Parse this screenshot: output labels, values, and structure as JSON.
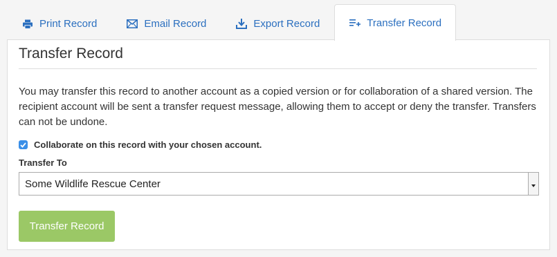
{
  "tabs": [
    {
      "label": "Print Record",
      "icon": "printer-icon",
      "active": false
    },
    {
      "label": "Email Record",
      "icon": "envelope-icon",
      "active": false
    },
    {
      "label": "Export Record",
      "icon": "download-icon",
      "active": false
    },
    {
      "label": "Transfer Record",
      "icon": "transfer-list-icon",
      "active": true
    }
  ],
  "panel": {
    "title": "Transfer Record",
    "description": "You may transfer this record to another account as a copied version or for collaboration of a shared version. The recipient account will be sent a transfer request message, allowing them to accept or deny the transfer. Transfers can not be undone.",
    "collaborate_checkbox": {
      "label": "Collaborate on this record with your chosen account.",
      "checked": true
    },
    "transfer_to": {
      "label": "Transfer To",
      "selected": "Some Wildlife Rescue Center"
    },
    "submit_label": "Transfer Record"
  },
  "colors": {
    "link": "#2b6fbf",
    "checkbox": "#3a8fe8",
    "button": "#9bc866",
    "background": "#f5f5f5"
  }
}
